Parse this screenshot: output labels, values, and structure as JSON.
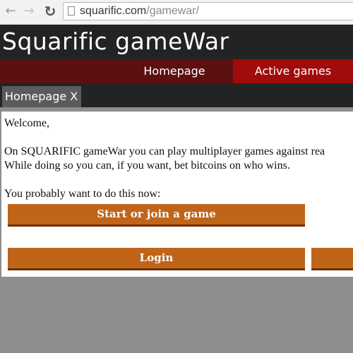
{
  "browser": {
    "url_host": "squarific.com",
    "url_path": "/gamewar/",
    "back_icon": "←",
    "forward_icon": "→",
    "reload_icon": "↻"
  },
  "site": {
    "title": "Squarific gameWar"
  },
  "menu": {
    "items": [
      {
        "label": "Homepage"
      },
      {
        "label": "Active games"
      }
    ]
  },
  "tabs": [
    {
      "label": "Homepage X"
    }
  ],
  "content": {
    "welcome": "Welcome,",
    "line1": "On SQUARIFIC gameWar you can play multiplayer games against rea",
    "line2": "While doing so you can, if you want, bet bitcoins on who wins.",
    "prompt": "You probably want to do this now:",
    "start_button": "Start or join a game",
    "login_button": "Login"
  }
}
